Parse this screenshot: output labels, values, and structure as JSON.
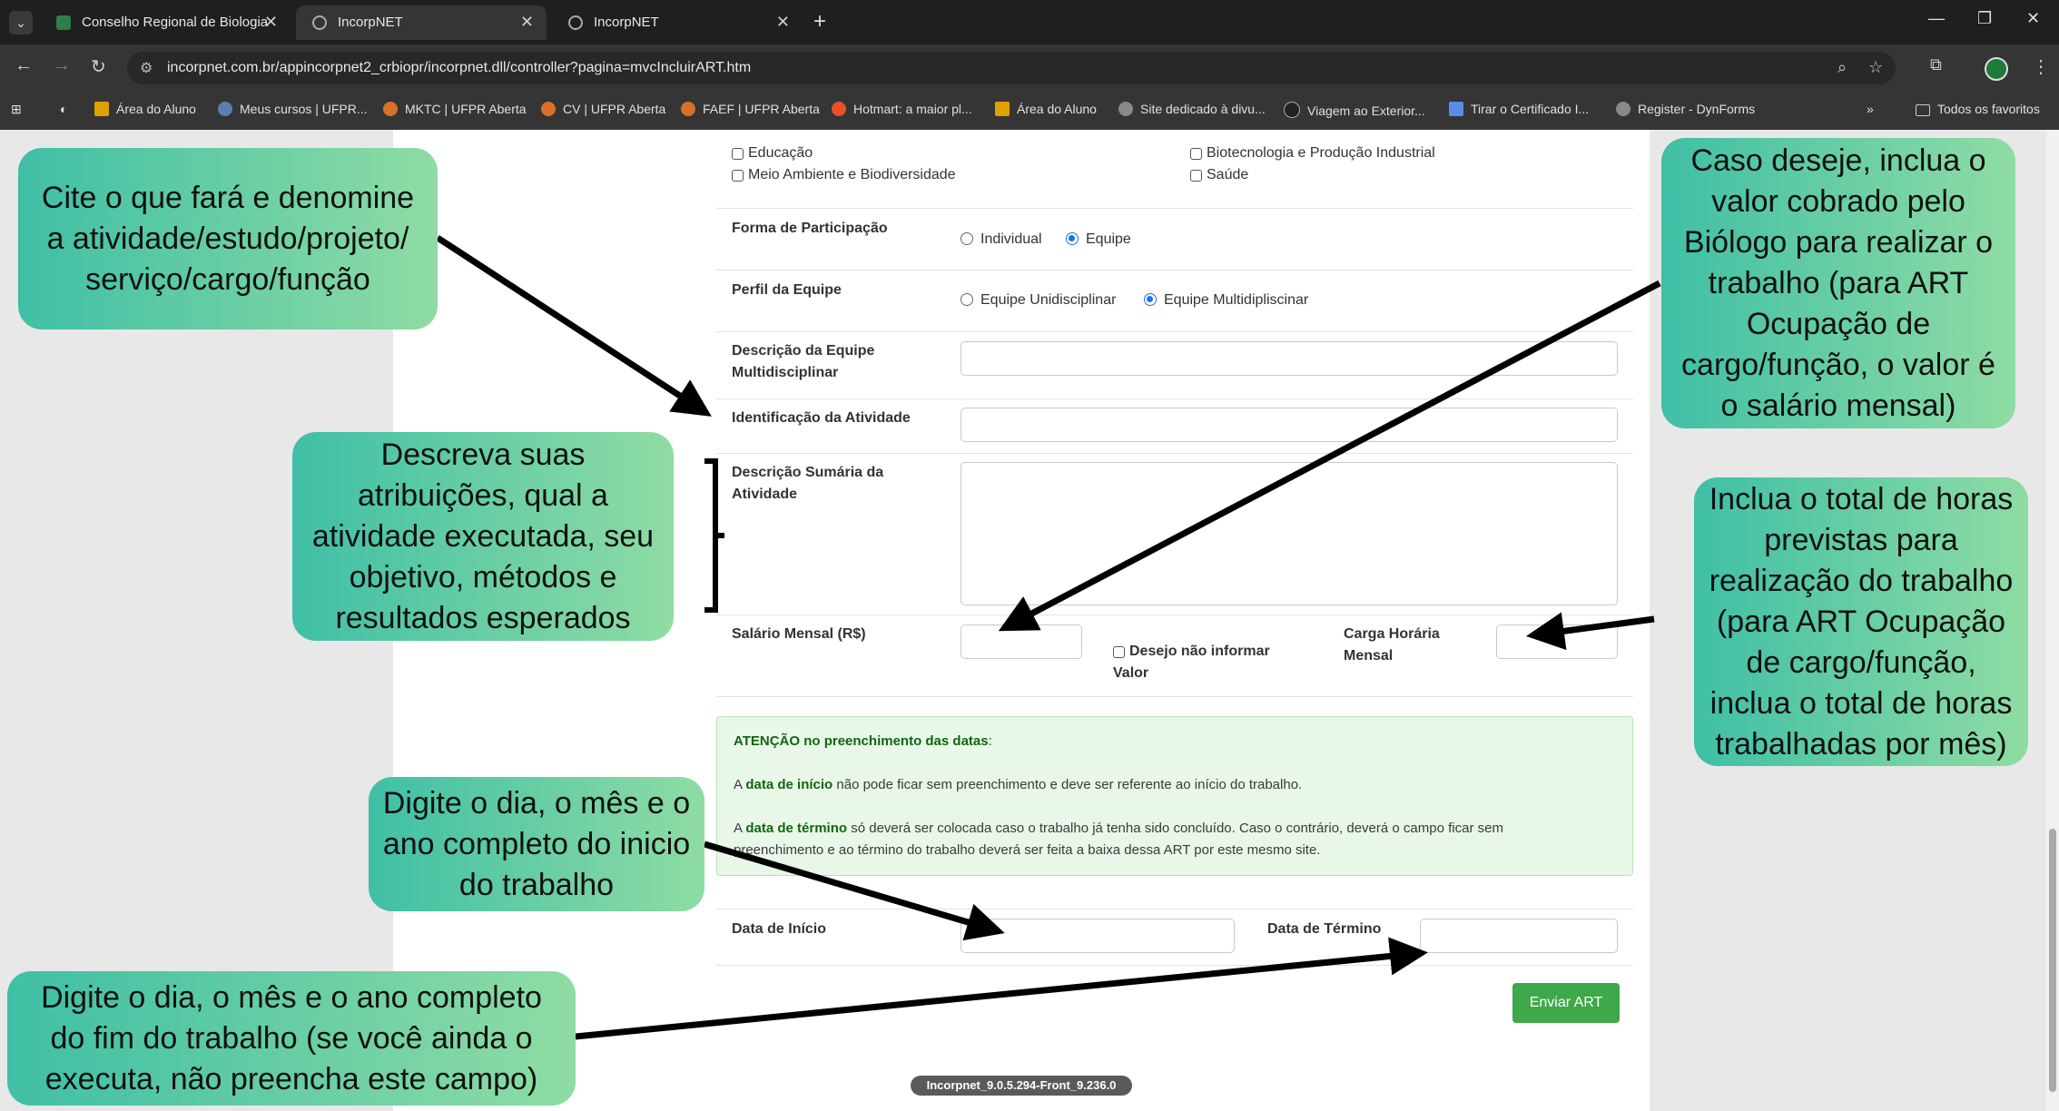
{
  "browser": {
    "tabs": [
      {
        "title": "Conselho Regional de Biologia",
        "active": false
      },
      {
        "title": "IncorpNET",
        "active": true
      },
      {
        "title": "IncorpNET",
        "active": false
      }
    ],
    "url": "incorpnet.com.br/appincorpnet2_crbiopr/incorpnet.dll/controller?pagina=mvcIncluirART.htm",
    "bookmarks": [
      "Área do Aluno",
      "Meus cursos | UFPR...",
      "MKTC | UFPR Aberta",
      "CV | UFPR Aberta",
      "FAEF | UFPR Aberta",
      "Hotmart: a maior pl...",
      "Área do Aluno",
      "Site dedicado à divu...",
      "Viagem ao Exterior...",
      "Tirar o Certificado I...",
      "Register - DynForms"
    ],
    "bookmarks_more": "»",
    "all_bookmarks": "Todos os favoritos"
  },
  "form": {
    "areas": {
      "left": [
        "Educação",
        "Meio Ambiente e Biodiversidade"
      ],
      "right": [
        "Biotecnologia e Produção Industrial",
        "Saúde"
      ]
    },
    "participation": {
      "label": "Forma de Participação",
      "options": [
        "Individual",
        "Equipe"
      ],
      "selected": "Equipe"
    },
    "team_profile": {
      "label": "Perfil da Equipe",
      "options": [
        "Equipe Unidisciplinar",
        "Equipe Multidipliscinar"
      ],
      "selected": "Equipe Multidipliscinar"
    },
    "team_description": {
      "label_line1": "Descrição da Equipe",
      "label_line2": "Multidisciplinar",
      "value": ""
    },
    "activity_id": {
      "label": "Identificação da Atividade",
      "value": ""
    },
    "activity_summary": {
      "label_line1": "Descrição Sumária da",
      "label_line2": "Atividade",
      "value": ""
    },
    "salary": {
      "label": "Salário Mensal (R$)",
      "value": ""
    },
    "no_inform": {
      "line1": "Desejo não informar",
      "line2": "Valor"
    },
    "workload": {
      "label_line1": "Carga Horária",
      "label_line2": "Mensal",
      "value": ""
    },
    "attention": {
      "title": "ATENÇÃO no preenchimento das datas",
      "title_suffix": ":",
      "p1_pre": "A ",
      "p1_bold": "data de início",
      "p1_post": " não pode ficar sem preenchimento e deve ser referente ao início do trabalho.",
      "p2_pre": "A ",
      "p2_bold": "data de término",
      "p2_post": " só deverá ser colocada caso o trabalho já tenha sido concluído. Caso o contrário, deverá o campo ficar sem",
      "p3": "preenchimento e ao término do trabalho deverá ser feita a baixa dessa ART por este mesmo site."
    },
    "start_date": {
      "label": "Data de Início",
      "value": ""
    },
    "end_date": {
      "label": "Data de Término",
      "value": ""
    },
    "submit": "Enviar ART",
    "version": "Incorpnet_9.0.5.294-Front_9.236.0"
  },
  "callouts": {
    "c1": "Cite o que fará e denomine a atividade/estudo/projeto/ serviço/cargo/função",
    "c2": "Descreva suas atribuições, qual a atividade executada, seu objetivo, métodos e resultados esperados",
    "c3": "Caso deseje, inclua o valor cobrado pelo Biólogo para realizar o trabalho (para ART Ocupação de cargo/função, o valor é o salário mensal)",
    "c4": "Inclua o total de horas previstas para realização do trabalho (para ART Ocupação de cargo/função, inclua o total de horas trabalhadas por mês)",
    "c5": "Digite o dia, o mês e o ano completo do inicio do trabalho",
    "c6": "Digite o dia, o mês e o ano completo do fim do trabalho (se você ainda o executa, não preencha este campo)"
  },
  "colors": {
    "callout_start": "#3fbfa6",
    "callout_end": "#8fdca3",
    "button": "#3ea84a",
    "alert_bg": "#e9f7e9"
  }
}
